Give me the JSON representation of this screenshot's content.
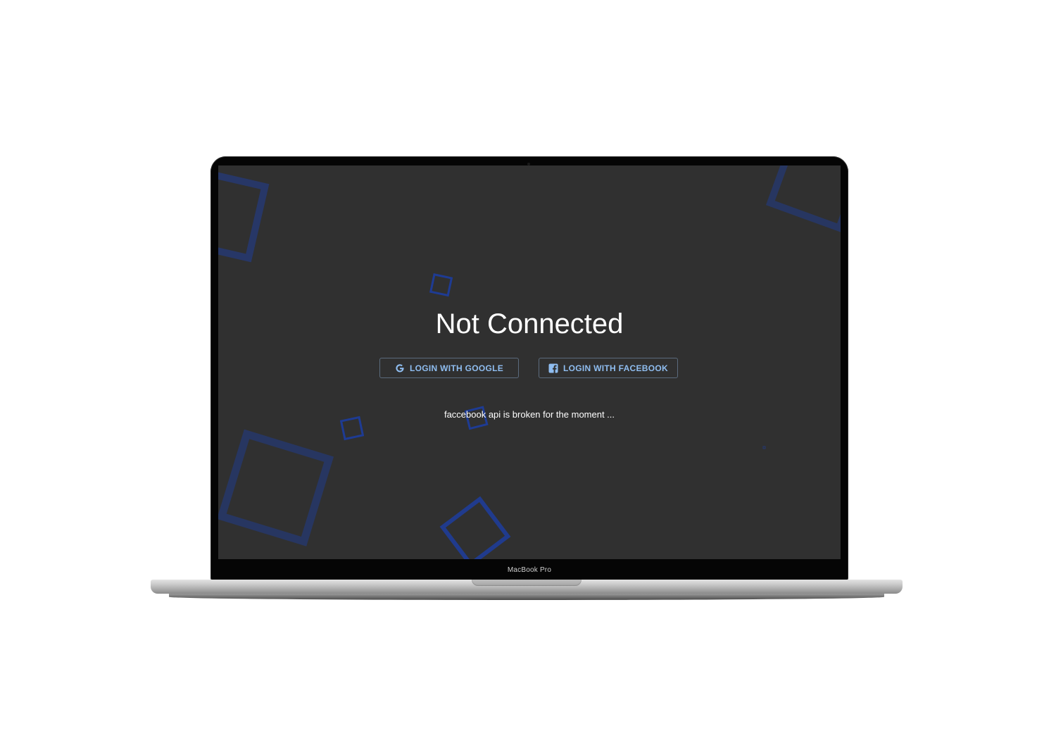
{
  "device": {
    "model_label": "MacBook Pro"
  },
  "app": {
    "title": "Not Connected",
    "buttons": {
      "google": {
        "label": "LOGIN WITH GOOGLE",
        "icon": "google-icon"
      },
      "facebook": {
        "label": "LOGIN WITH FACEBOOK",
        "icon": "facebook-icon"
      }
    },
    "note": "faccebook api is broken for the moment ..."
  },
  "colors": {
    "screen_background": "#303030",
    "button_text": "#8fbdf0",
    "decorative_squares": "#1a3aa8"
  }
}
